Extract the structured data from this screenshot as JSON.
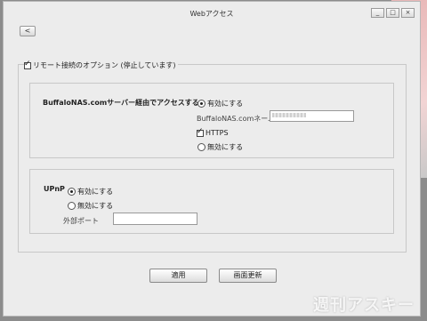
{
  "window": {
    "title": "Webアクセス",
    "controls": {
      "minimize": "_",
      "maximize": "□",
      "close": "×"
    },
    "back_label": "<"
  },
  "remote": {
    "checked": true,
    "label": "リモート接続のオプション (停止しています)"
  },
  "buffalo": {
    "heading": "BuffaloNAS.comサーバー経由でアクセスする",
    "enable_label": "有効にする",
    "enable_selected": true,
    "name_label": "BuffaloNAS.comネーム",
    "name_value": "",
    "https_label": "HTTPS",
    "https_checked": true,
    "disable_label": "無効にする"
  },
  "upnp": {
    "heading": "UPnP",
    "enable_label": "有効にする",
    "enable_selected": true,
    "disable_label": "無効にする",
    "port_label": "外部ポート",
    "port_value": ""
  },
  "footer": {
    "apply_label": "適用",
    "refresh_label": "画面更新"
  },
  "watermark": "週刊アスキー"
}
